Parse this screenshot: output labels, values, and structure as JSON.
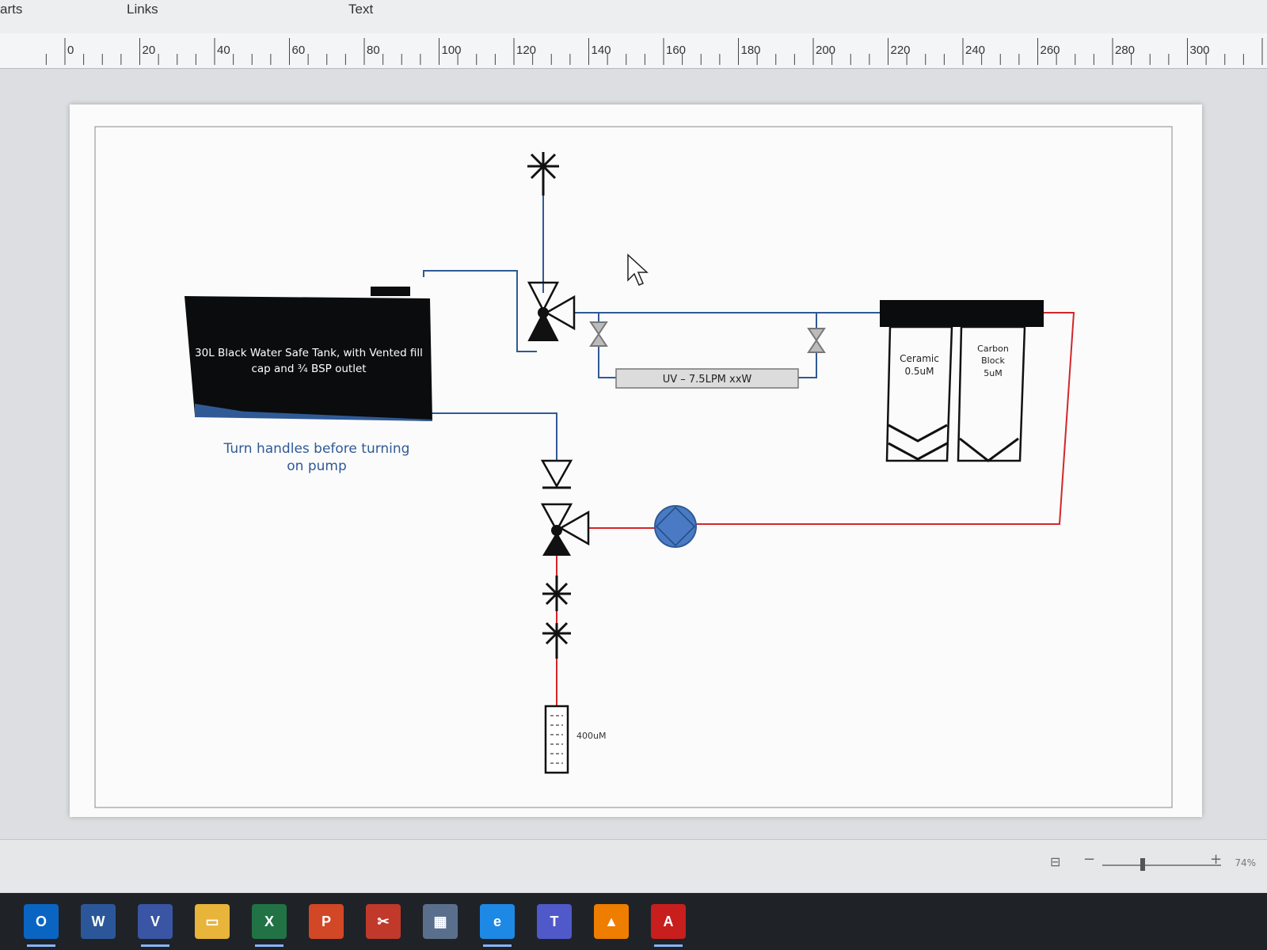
{
  "toolbar": {
    "tab_left_fragment": "arts",
    "tab_links": "Links",
    "tab_text": "Text"
  },
  "ruler": {
    "ticks": [
      "0",
      "20",
      "40",
      "60",
      "80",
      "100",
      "120",
      "140",
      "160",
      "180",
      "200",
      "220",
      "240",
      "260",
      "280",
      "300"
    ]
  },
  "diagram": {
    "tank_label_line1": "30L Black Water Safe Tank, with Vented fill",
    "tank_label_line2": "cap and ¾ BSP outlet",
    "instruction_line1": "Turn handles before turning",
    "instruction_line2": "on pump",
    "uv_label": "UV – 7.5LPM xxW",
    "filter1_line1": "Ceramic",
    "filter1_line2": "0.5uM",
    "filter2_line1": "Carbon",
    "filter2_line2": "Block",
    "filter2_line3": "5uM",
    "strainer_label": "400uM",
    "colors": {
      "blue_pipe": "#2f5a96",
      "red_pipe": "#d3262b",
      "tank_fill": "#0b0c0e",
      "pump_fill": "#4a7ac4"
    }
  },
  "status": {
    "zoom_label": "74%",
    "zoom_minus": "−",
    "zoom_plus": "+"
  },
  "taskbar": {
    "apps": [
      {
        "name": "outlook-icon",
        "glyph": "O",
        "color": "#0a64c2"
      },
      {
        "name": "word-icon",
        "glyph": "W",
        "color": "#2b579a"
      },
      {
        "name": "visio-icon",
        "glyph": "V",
        "color": "#3955a3"
      },
      {
        "name": "file-explorer-icon",
        "glyph": "▭",
        "color": "#e8b43a"
      },
      {
        "name": "excel-icon",
        "glyph": "X",
        "color": "#217346"
      },
      {
        "name": "powerpoint-icon",
        "glyph": "P",
        "color": "#d24726"
      },
      {
        "name": "snipping-tool-icon",
        "glyph": "✂",
        "color": "#c0392b"
      },
      {
        "name": "calculator-icon",
        "glyph": "▦",
        "color": "#5a6f8c"
      },
      {
        "name": "edge-icon",
        "glyph": "e",
        "color": "#1e88e5"
      },
      {
        "name": "teams-icon",
        "glyph": "T",
        "color": "#5059c9"
      },
      {
        "name": "vlc-icon",
        "glyph": "▲",
        "color": "#ef7d00"
      },
      {
        "name": "acrobat-icon",
        "glyph": "A",
        "color": "#c81e1e"
      }
    ]
  }
}
